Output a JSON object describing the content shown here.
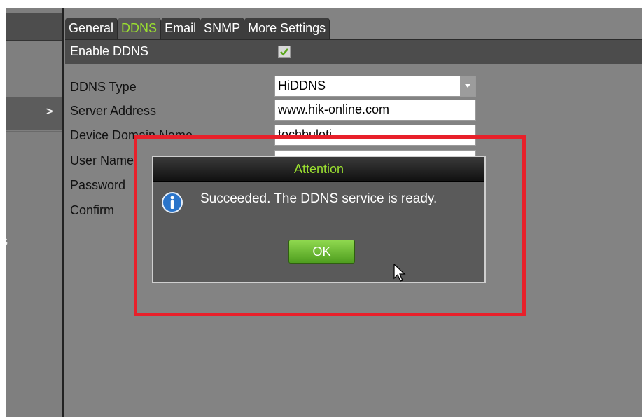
{
  "tabs": [
    {
      "label": "General",
      "active": false
    },
    {
      "label": "DDNS",
      "active": true
    },
    {
      "label": "Email",
      "active": false
    },
    {
      "label": "SNMP",
      "active": false
    },
    {
      "label": "More Settings",
      "active": false
    }
  ],
  "form": {
    "enable_ddns_label": "Enable DDNS",
    "enable_ddns_checked": true,
    "ddns_type_label": "DDNS Type",
    "ddns_type_value": "HiDDNS",
    "server_address_label": "Server Address",
    "server_address_value": "www.hik-online.com",
    "device_domain_label": "Device Domain Name",
    "device_domain_value": "techbuleti",
    "user_name_label": "User Name",
    "password_label": "Password",
    "confirm_label": "Confirm"
  },
  "sidebar": {
    "chevron": ">",
    "clipped_text": "s"
  },
  "dialog": {
    "title": "Attention",
    "message": "Succeeded. The DDNS service is ready.",
    "ok_label": "OK"
  },
  "colors": {
    "accent_green": "#9adf30",
    "highlight_red": "#e8202a"
  },
  "icons": {
    "info": "info-icon",
    "checkbox": "checkmark-icon",
    "dropdown": "chevron-down-icon",
    "cursor": "mouse-pointer-icon"
  }
}
